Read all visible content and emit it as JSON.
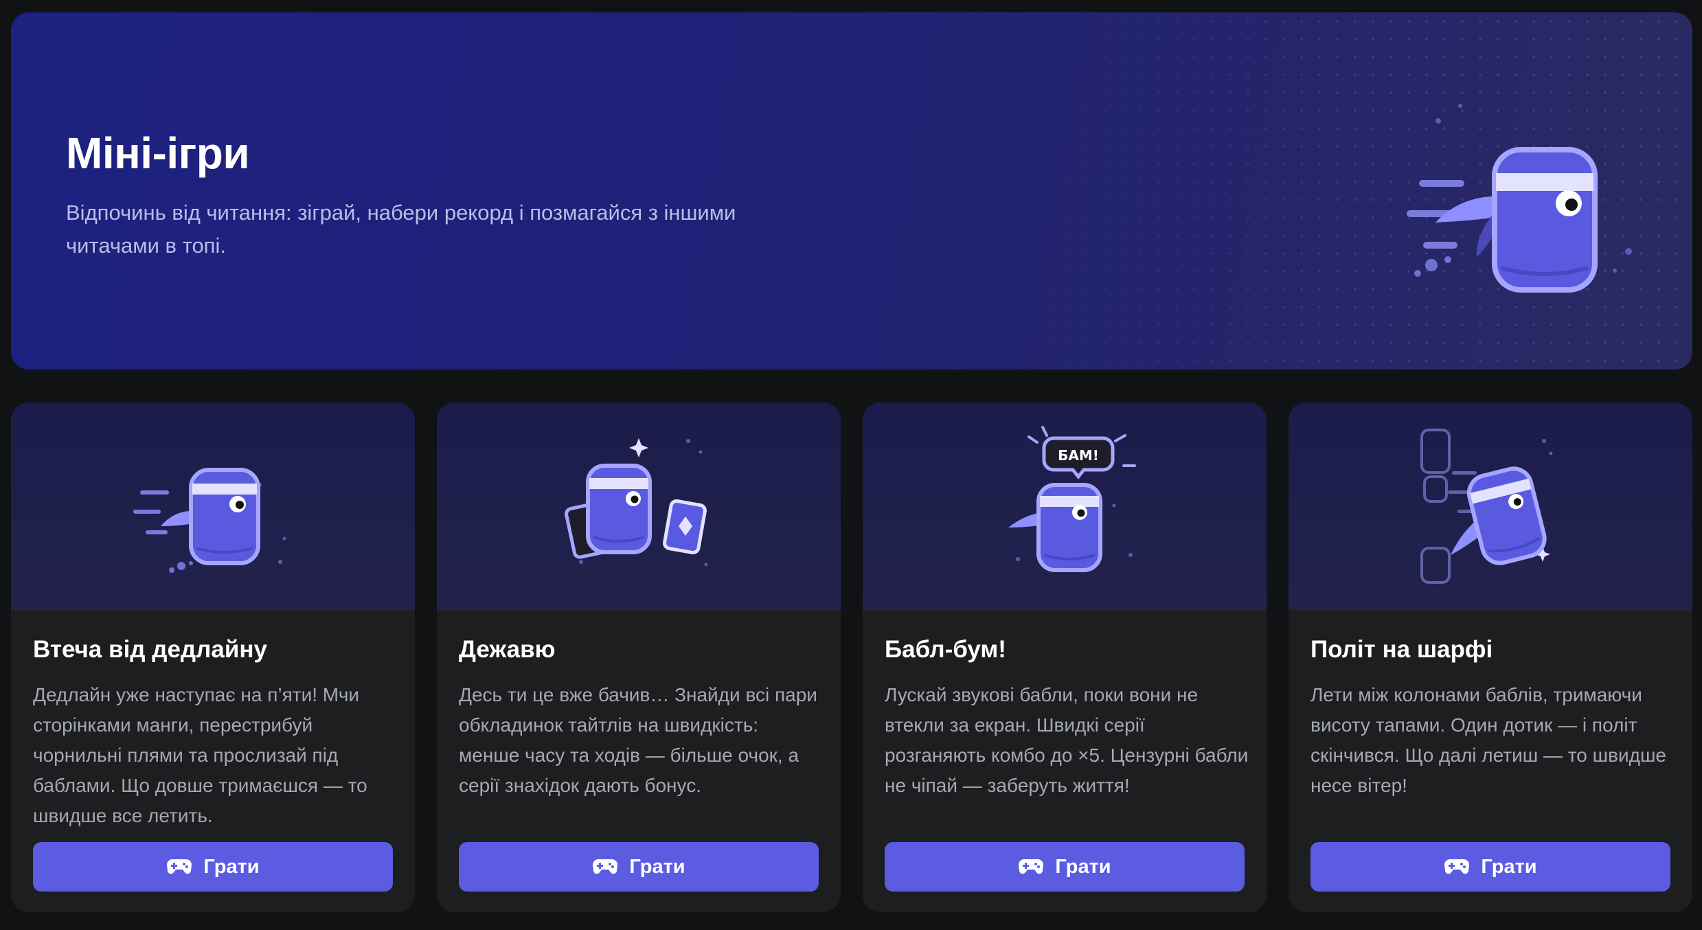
{
  "hero": {
    "title": "Міні-ігри",
    "description": "Відпочинь від читання: зіграй, набери рекорд і позмагайся з іншими читачами в топі."
  },
  "cards": [
    {
      "title": "Втеча від дедлайну",
      "description": "Дедлайн уже наступає на п’яти! Мчи сторінками манги, перестрибуй чорнильні плями та прослизай під баблами. Що довше тримаєшся — то швидше все летить.",
      "button_label": "Грати",
      "icon": "gamepad-icon"
    },
    {
      "title": "Дежавю",
      "description": "Десь ти це вже бачив… Знайди всі пари обкладинок тайтлів на швидкість: менше часу та ходів — більше очок, а серії знахідок дають бонус.",
      "button_label": "Грати",
      "icon": "gamepad-icon"
    },
    {
      "title": "Бабл-бум!",
      "description": "Лускай звукові бабли, поки вони не втекли за екран. Швидкі серії розганяють комбо до ×5. Цензурні бабли не чіпай — заберуть життя!",
      "button_label": "Грати",
      "icon": "gamepad-icon",
      "bubble_text": "БАМ!"
    },
    {
      "title": "Політ на шарфі",
      "description": "Лети між колонами баблів, тримаючи висоту тапами. Один дотик — і політ скінчився. Що далі летиш — то швидше несе вітер!",
      "button_label": "Грати",
      "icon": "gamepad-icon"
    }
  ],
  "colors": {
    "accent": "#5b5ce2",
    "mascot": "#5a5ae0",
    "mascot_outline": "#a6a6ff",
    "hero_bg": "#1f2178",
    "card_bg": "#1d1e20"
  }
}
